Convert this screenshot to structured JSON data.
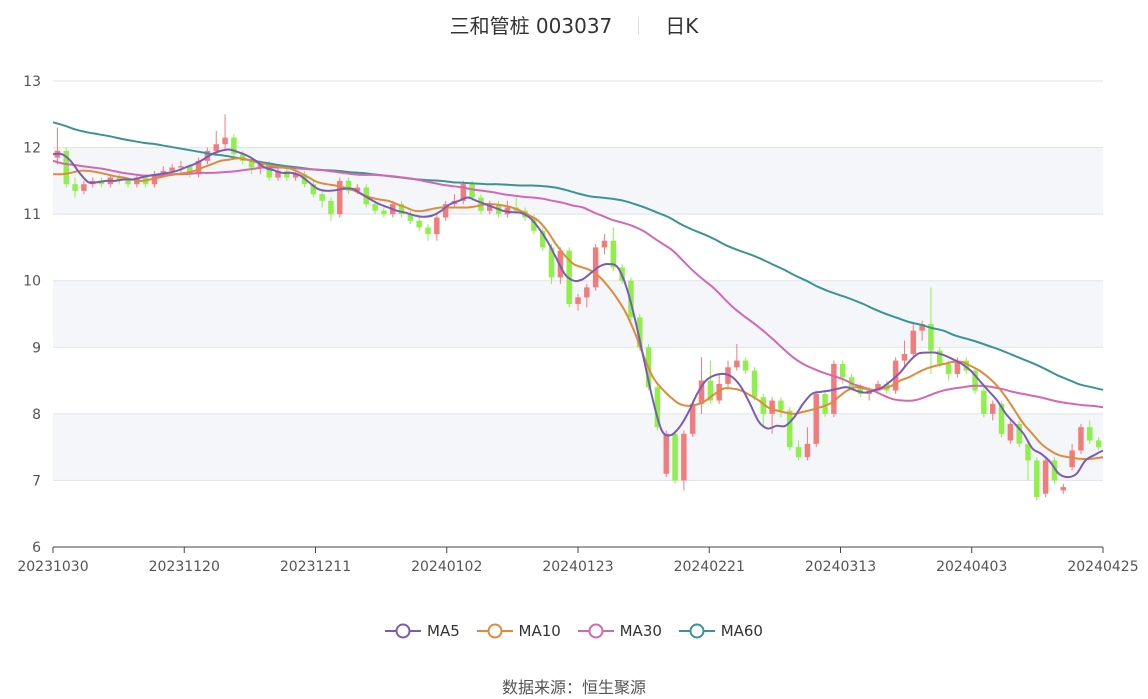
{
  "header": {
    "stock": "三和管桩 003037",
    "period": "日K"
  },
  "source": {
    "label": "数据来源：",
    "value": "恒生聚源"
  },
  "colors": {
    "up": "#f27c7c",
    "down": "#8ff04a",
    "ma5": "#7b5bb8",
    "ma10": "#e08a3c",
    "ma30": "#d567b3",
    "ma60": "#3a9493",
    "band": "#f5f6fa",
    "grid": "#dde3ee"
  },
  "chart_data": {
    "type": "candlestick",
    "ylim": [
      6,
      13
    ],
    "y_ticks": [
      "6",
      "7",
      "8",
      "9",
      "10",
      "11",
      "12",
      "13"
    ],
    "x_ticks": [
      "20231030",
      "20231120",
      "20231211",
      "20240102",
      "20240123",
      "20240221",
      "20240313",
      "20240403",
      "20240425"
    ],
    "legend": [
      {
        "name": "MA5",
        "color": "#7b5bb8"
      },
      {
        "name": "MA10",
        "color": "#e08a3c"
      },
      {
        "name": "MA30",
        "color": "#d567b3"
      },
      {
        "name": "MA60",
        "color": "#3a9493"
      }
    ],
    "candles": [
      [
        11.85,
        11.95,
        11.75,
        12.3
      ],
      [
        11.95,
        11.45,
        11.4,
        12.0
      ],
      [
        11.45,
        11.35,
        11.25,
        11.55
      ],
      [
        11.35,
        11.45,
        11.3,
        11.5
      ],
      [
        11.45,
        11.5,
        11.4,
        11.55
      ],
      [
        11.5,
        11.45,
        11.4,
        11.55
      ],
      [
        11.45,
        11.55,
        11.4,
        11.6
      ],
      [
        11.55,
        11.5,
        11.45,
        11.6
      ],
      [
        11.5,
        11.45,
        11.4,
        11.55
      ],
      [
        11.45,
        11.55,
        11.4,
        11.6
      ],
      [
        11.55,
        11.45,
        11.4,
        11.6
      ],
      [
        11.45,
        11.6,
        11.4,
        11.65
      ],
      [
        11.6,
        11.65,
        11.55,
        11.72
      ],
      [
        11.65,
        11.7,
        11.6,
        11.75
      ],
      [
        11.7,
        11.72,
        11.62,
        11.8
      ],
      [
        11.72,
        11.6,
        11.55,
        11.75
      ],
      [
        11.6,
        11.8,
        11.55,
        11.85
      ],
      [
        11.8,
        11.95,
        11.75,
        12.0
      ],
      [
        11.95,
        12.05,
        11.9,
        12.25
      ],
      [
        12.05,
        12.15,
        11.95,
        12.5
      ],
      [
        12.15,
        11.9,
        11.85,
        12.2
      ],
      [
        11.9,
        11.8,
        11.75,
        11.95
      ],
      [
        11.8,
        11.7,
        11.6,
        11.85
      ],
      [
        11.7,
        11.75,
        11.6,
        11.8
      ],
      [
        11.75,
        11.55,
        11.5,
        11.8
      ],
      [
        11.55,
        11.65,
        11.5,
        11.7
      ],
      [
        11.65,
        11.55,
        11.5,
        11.7
      ],
      [
        11.55,
        11.6,
        11.5,
        11.65
      ],
      [
        11.6,
        11.45,
        11.4,
        11.65
      ],
      [
        11.45,
        11.3,
        11.25,
        11.5
      ],
      [
        11.3,
        11.2,
        11.1,
        11.35
      ],
      [
        11.2,
        11.0,
        10.9,
        11.25
      ],
      [
        11.0,
        11.5,
        10.95,
        11.55
      ],
      [
        11.5,
        11.35,
        11.3,
        11.55
      ],
      [
        11.35,
        11.4,
        11.3,
        11.45
      ],
      [
        11.4,
        11.15,
        11.1,
        11.45
      ],
      [
        11.15,
        11.05,
        11.0,
        11.2
      ],
      [
        11.05,
        11.0,
        10.95,
        11.1
      ],
      [
        11.0,
        11.15,
        10.95,
        11.2
      ],
      [
        11.15,
        11.0,
        10.95,
        11.2
      ],
      [
        11.0,
        10.9,
        10.85,
        11.05
      ],
      [
        10.9,
        10.8,
        10.75,
        10.95
      ],
      [
        10.8,
        10.7,
        10.6,
        10.85
      ],
      [
        10.7,
        10.95,
        10.6,
        11.0
      ],
      [
        10.95,
        11.15,
        10.9,
        11.2
      ],
      [
        11.15,
        11.2,
        11.1,
        11.3
      ],
      [
        11.2,
        11.45,
        11.15,
        11.5
      ],
      [
        11.45,
        11.25,
        11.2,
        11.5
      ],
      [
        11.25,
        11.05,
        11.0,
        11.3
      ],
      [
        11.05,
        11.15,
        11.0,
        11.2
      ],
      [
        11.15,
        11.0,
        10.95,
        11.2
      ],
      [
        11.0,
        11.1,
        10.95,
        11.2
      ],
      [
        11.1,
        11.05,
        11.0,
        11.25
      ],
      [
        11.05,
        10.95,
        10.9,
        11.1
      ],
      [
        10.95,
        10.75,
        10.7,
        11.0
      ],
      [
        10.75,
        10.5,
        10.45,
        10.8
      ],
      [
        10.5,
        10.05,
        9.95,
        10.55
      ],
      [
        10.05,
        10.45,
        9.95,
        10.5
      ],
      [
        10.45,
        9.65,
        9.6,
        10.5
      ],
      [
        9.65,
        9.75,
        9.55,
        9.8
      ],
      [
        9.75,
        9.9,
        9.6,
        9.95
      ],
      [
        9.9,
        10.5,
        9.85,
        10.55
      ],
      [
        10.5,
        10.6,
        10.4,
        10.7
      ],
      [
        10.6,
        10.2,
        10.15,
        10.8
      ],
      [
        10.2,
        10.0,
        9.95,
        10.25
      ],
      [
        10.0,
        9.45,
        9.4,
        10.05
      ],
      [
        9.45,
        9.0,
        8.95,
        9.5
      ],
      [
        9.0,
        8.4,
        8.35,
        9.05
      ],
      [
        8.4,
        7.8,
        7.75,
        8.45
      ],
      [
        7.1,
        7.7,
        7.05,
        7.75
      ],
      [
        7.7,
        7.0,
        6.95,
        7.75
      ],
      [
        7.0,
        7.7,
        6.85,
        7.75
      ],
      [
        7.7,
        8.15,
        7.65,
        8.2
      ],
      [
        8.15,
        8.5,
        8.0,
        8.85
      ],
      [
        8.5,
        8.2,
        8.15,
        8.8
      ],
      [
        8.2,
        8.45,
        8.15,
        8.6
      ],
      [
        8.45,
        8.7,
        8.4,
        8.8
      ],
      [
        8.7,
        8.8,
        8.65,
        9.05
      ],
      [
        8.8,
        8.65,
        8.6,
        8.85
      ],
      [
        8.65,
        8.25,
        8.2,
        8.7
      ],
      [
        8.25,
        8.0,
        7.8,
        8.3
      ],
      [
        8.0,
        8.2,
        7.7,
        8.25
      ],
      [
        8.2,
        8.05,
        7.95,
        8.25
      ],
      [
        8.05,
        7.5,
        7.45,
        8.1
      ],
      [
        7.5,
        7.35,
        7.3,
        7.6
      ],
      [
        7.35,
        7.55,
        7.3,
        7.8
      ],
      [
        7.55,
        8.3,
        7.5,
        8.35
      ],
      [
        8.3,
        8.0,
        7.95,
        8.35
      ],
      [
        8.0,
        8.75,
        7.95,
        8.8
      ],
      [
        8.75,
        8.55,
        8.45,
        8.8
      ],
      [
        8.55,
        8.4,
        8.35,
        8.6
      ],
      [
        8.4,
        8.3,
        8.25,
        8.45
      ],
      [
        8.3,
        8.35,
        8.2,
        8.4
      ],
      [
        8.35,
        8.45,
        8.3,
        8.5
      ],
      [
        8.45,
        8.35,
        8.3,
        8.5
      ],
      [
        8.35,
        8.8,
        8.3,
        8.85
      ],
      [
        8.8,
        8.9,
        8.7,
        9.1
      ],
      [
        8.9,
        9.25,
        8.85,
        9.35
      ],
      [
        9.25,
        9.35,
        9.1,
        9.4
      ],
      [
        9.35,
        8.95,
        8.6,
        9.9
      ],
      [
        8.95,
        8.75,
        8.7,
        9.0
      ],
      [
        8.75,
        8.6,
        8.5,
        8.8
      ],
      [
        8.6,
        8.8,
        8.55,
        8.85
      ],
      [
        8.8,
        8.65,
        8.6,
        8.85
      ],
      [
        8.65,
        8.35,
        8.3,
        8.7
      ],
      [
        8.35,
        8.0,
        7.95,
        8.4
      ],
      [
        8.0,
        8.15,
        7.9,
        8.2
      ],
      [
        8.15,
        7.7,
        7.65,
        8.2
      ],
      [
        7.6,
        7.85,
        7.55,
        7.9
      ],
      [
        7.85,
        7.55,
        7.5,
        7.9
      ],
      [
        7.55,
        7.3,
        7.0,
        7.6
      ],
      [
        7.3,
        6.75,
        6.7,
        7.35
      ],
      [
        6.8,
        7.3,
        6.75,
        7.35
      ],
      [
        7.3,
        7.0,
        6.95,
        7.35
      ],
      [
        6.85,
        6.9,
        6.8,
        6.95
      ],
      [
        7.2,
        7.45,
        7.15,
        7.55
      ],
      [
        7.45,
        7.8,
        7.4,
        7.85
      ],
      [
        7.8,
        7.6,
        7.55,
        7.9
      ],
      [
        7.6,
        7.5,
        7.45,
        7.65
      ]
    ],
    "ma5": [
      11.9,
      11.9,
      11.8,
      11.62,
      11.48,
      11.48,
      11.5,
      11.5,
      11.52,
      11.52,
      11.55,
      11.58,
      11.6,
      11.62,
      11.65,
      11.7,
      11.75,
      11.82,
      11.9,
      11.95,
      11.97,
      11.93,
      11.88,
      11.8,
      11.7,
      11.66,
      11.62,
      11.62,
      11.58,
      11.48,
      11.38,
      11.35,
      11.36,
      11.38,
      11.38,
      11.3,
      11.22,
      11.15,
      11.1,
      11.05,
      11.02,
      10.98,
      10.96,
      10.98,
      11.05,
      11.15,
      11.2,
      11.25,
      11.2,
      11.15,
      11.1,
      11.05,
      11.03,
      11.02,
      10.95,
      10.8,
      10.6,
      10.35,
      10.1,
      10.0,
      10.02,
      10.12,
      10.22,
      10.25,
      10.2,
      9.9,
      9.4,
      8.8,
      8.2,
      7.75,
      7.68,
      7.8,
      8.02,
      8.3,
      8.5,
      8.58,
      8.6,
      8.55,
      8.4,
      8.15,
      7.88,
      7.78,
      7.82,
      7.82,
      7.95,
      8.15,
      8.3,
      8.33,
      8.35,
      8.38,
      8.4,
      8.35,
      8.32,
      8.35,
      8.4,
      8.5,
      8.62,
      8.78,
      8.9,
      8.92,
      8.92,
      8.88,
      8.82,
      8.75,
      8.65,
      8.5,
      8.35,
      8.2,
      8.0,
      7.85,
      7.7,
      7.48,
      7.4,
      7.28,
      7.1,
      7.05,
      7.1,
      7.3,
      7.38,
      7.45
    ],
    "ma10": [
      11.6,
      11.6,
      11.62,
      11.65,
      11.65,
      11.63,
      11.6,
      11.57,
      11.55,
      11.52,
      11.5,
      11.52,
      11.55,
      11.58,
      11.6,
      11.62,
      11.65,
      11.7,
      11.75,
      11.8,
      11.82,
      11.84,
      11.82,
      11.78,
      11.75,
      11.72,
      11.7,
      11.68,
      11.62,
      11.55,
      11.48,
      11.45,
      11.43,
      11.4,
      11.36,
      11.3,
      11.25,
      11.22,
      11.2,
      11.15,
      11.1,
      11.05,
      11.05,
      11.08,
      11.1,
      11.1,
      11.1,
      11.1,
      11.12,
      11.15,
      11.15,
      11.13,
      11.1,
      11.05,
      10.98,
      10.9,
      10.75,
      10.55,
      10.38,
      10.25,
      10.2,
      10.15,
      10.05,
      9.9,
      9.72,
      9.5,
      9.2,
      8.85,
      8.55,
      8.38,
      8.25,
      8.15,
      8.12,
      8.14,
      8.2,
      8.3,
      8.38,
      8.38,
      8.35,
      8.28,
      8.2,
      8.1,
      8.05,
      8.02,
      8.0,
      8.03,
      8.06,
      8.1,
      8.15,
      8.25,
      8.35,
      8.4,
      8.38,
      8.36,
      8.38,
      8.42,
      8.5,
      8.55,
      8.62,
      8.68,
      8.72,
      8.75,
      8.78,
      8.78,
      8.72,
      8.65,
      8.55,
      8.42,
      8.25,
      8.05,
      7.85,
      7.7,
      7.55,
      7.45,
      7.38,
      7.35,
      7.33,
      7.32,
      7.33,
      7.35
    ],
    "ma30": [
      11.8,
      11.76,
      11.74,
      11.72,
      11.7,
      11.68,
      11.65,
      11.62,
      11.6,
      11.58,
      11.58,
      11.58,
      11.6,
      11.6,
      11.61,
      11.62,
      11.62,
      11.63,
      11.64,
      11.66,
      11.68,
      11.7,
      11.7,
      11.7,
      11.69,
      11.68,
      11.67,
      11.66,
      11.64,
      11.62,
      11.6,
      11.59,
      11.59,
      11.58,
      11.57,
      11.55,
      11.53,
      11.5,
      11.47,
      11.44,
      11.42,
      11.4,
      11.37,
      11.35,
      11.33,
      11.3,
      11.28,
      11.26,
      11.25,
      11.23,
      11.2,
      11.17,
      11.13,
      11.1,
      11.03,
      10.97,
      10.91,
      10.87,
      10.82,
      10.75,
      10.65,
      10.55,
      10.45,
      10.3,
      10.15,
      10.02,
      9.9,
      9.75,
      9.6,
      9.48,
      9.37,
      9.25,
      9.12,
      8.98,
      8.85,
      8.75,
      8.68,
      8.62,
      8.57,
      8.52,
      8.45,
      8.4,
      8.35,
      8.28,
      8.22,
      8.2,
      8.2,
      8.24,
      8.3,
      8.35,
      8.38,
      8.4,
      8.42,
      8.42,
      8.4,
      8.37,
      8.33,
      8.3,
      8.27,
      8.24,
      8.2,
      8.17,
      8.15,
      8.13,
      8.12,
      8.1
    ],
    "ma60": [
      12.38,
      12.33,
      12.27,
      12.23,
      12.2,
      12.17,
      12.13,
      12.1,
      12.07,
      12.05,
      12.02,
      11.99,
      11.96,
      11.93,
      11.9,
      11.88,
      11.85,
      11.82,
      11.79,
      11.76,
      11.73,
      11.71,
      11.69,
      11.67,
      11.66,
      11.65,
      11.63,
      11.62,
      11.6,
      11.58,
      11.56,
      11.54,
      11.52,
      11.51,
      11.5,
      11.48,
      11.47,
      11.46,
      11.45,
      11.45,
      11.44,
      11.43,
      11.43,
      11.42,
      11.4,
      11.36,
      11.31,
      11.27,
      11.25,
      11.23,
      11.2,
      11.15,
      11.09,
      11.02,
      10.95,
      10.85,
      10.77,
      10.7,
      10.62,
      10.53,
      10.46,
      10.4,
      10.33,
      10.25,
      10.17,
      10.08,
      10.0,
      9.91,
      9.84,
      9.78,
      9.72,
      9.65,
      9.57,
      9.5,
      9.44,
      9.38,
      9.34,
      9.29,
      9.25,
      9.18,
      9.13,
      9.08,
      9.02,
      8.96,
      8.89,
      8.82,
      8.75,
      8.67,
      8.58,
      8.51,
      8.44,
      8.4,
      8.36
    ]
  }
}
